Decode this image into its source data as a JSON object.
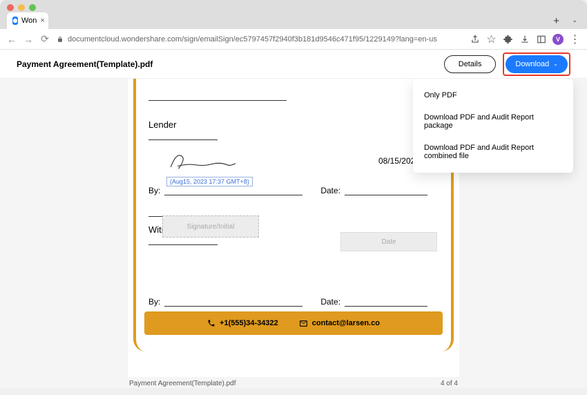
{
  "browser": {
    "tab_title": "Won",
    "url": "documentcloud.wondershare.com/sign/emailSign/ec5797457f2940f3b181d9546c471f95/1229149?lang=en-us",
    "avatar_letter": "V"
  },
  "header": {
    "doc_title": "Payment Agreement(Template).pdf",
    "details_label": "Details",
    "download_label": "Download"
  },
  "dropdown": {
    "items": [
      "Only PDF",
      "Download PDF and Audit Report package",
      "Download PDF and Audit Report combined file"
    ]
  },
  "document": {
    "lender_label": "Lender",
    "witness_label": "Witness",
    "by_label": "By:",
    "date_label": "Date:",
    "sig_timestamp": "(Aug15, 2023 17:37 GMT+8)",
    "date_value": "08/15/2023",
    "placeholder_sig": "Signature/Initial",
    "placeholder_date": "Date",
    "phone": "+1(555)34-34322",
    "email": "contact@larsen.co"
  },
  "pager": {
    "file_name": "Payment Agreement(Template).pdf",
    "page_indicator": "4 of 4"
  },
  "colors": {
    "accent": "#1b7aff",
    "highlight_border": "#e83828",
    "doc_border": "#df9a1f"
  }
}
